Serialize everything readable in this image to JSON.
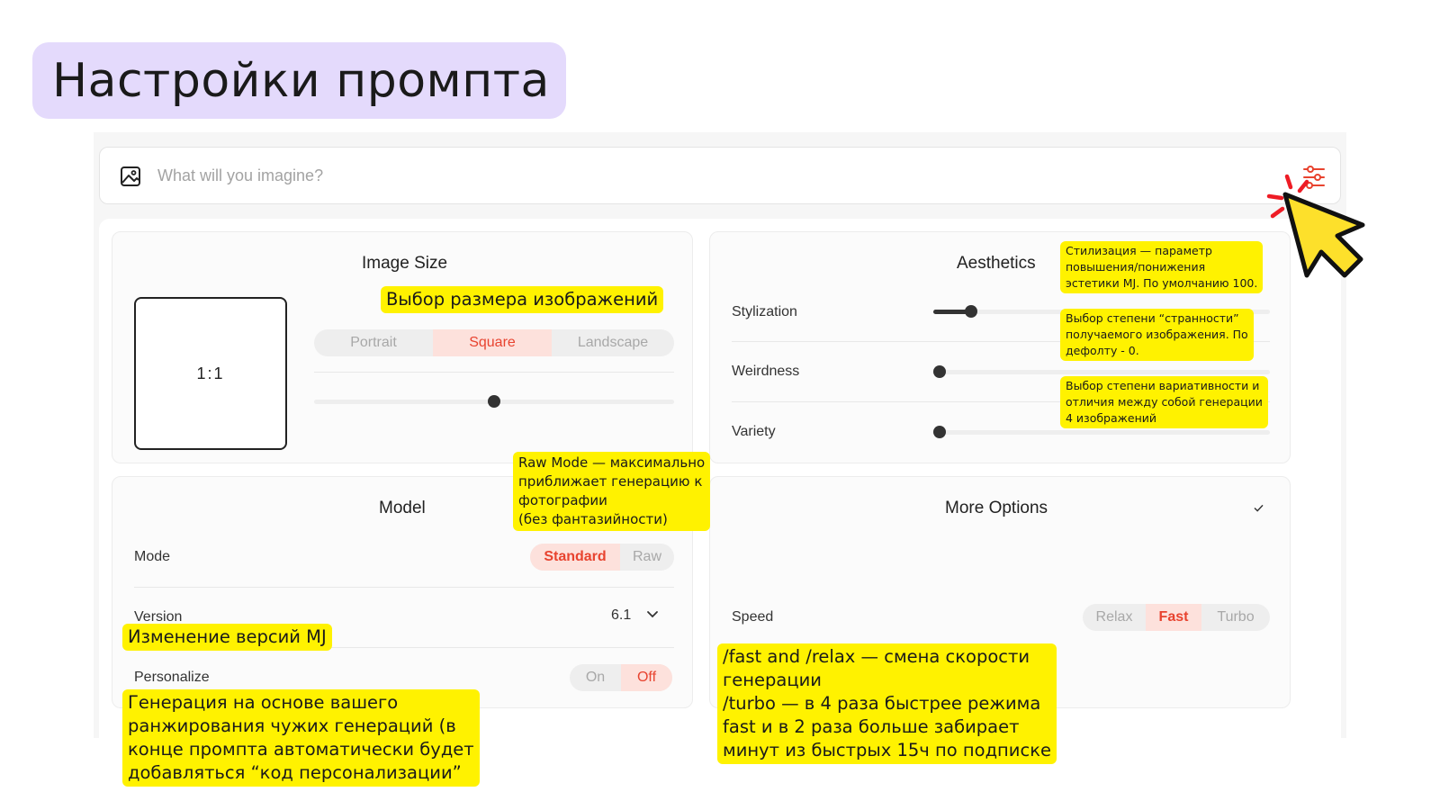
{
  "slide": {
    "title": "Настройки промпта"
  },
  "prompt": {
    "placeholder": "What will you imagine?"
  },
  "image_size": {
    "title": "Image Size",
    "aspect": "1:1",
    "orientation_options": [
      "Portrait",
      "Square",
      "Landscape"
    ],
    "orientation_selected": "Square",
    "slider_value": 0.5
  },
  "aesthetics": {
    "title": "Aesthetics",
    "rows": [
      {
        "label": "Stylization",
        "value": 0.1
      },
      {
        "label": "Weirdness",
        "value": 0
      },
      {
        "label": "Variety",
        "value": 0
      }
    ]
  },
  "model": {
    "title": "Model",
    "mode_label": "Mode",
    "mode_options": [
      "Standard",
      "Raw"
    ],
    "mode_selected": "Standard",
    "version_label": "Version",
    "version_value": "6.1",
    "personalize_label": "Personalize",
    "personalize_options": [
      "On",
      "Off"
    ],
    "personalize_selected": "Off"
  },
  "more_options": {
    "title": "More Options",
    "speed_label": "Speed",
    "speed_options": [
      "Relax",
      "Fast",
      "Turbo"
    ],
    "speed_selected": "Fast"
  },
  "annotations": {
    "image_size": "Выбор размера изображений",
    "stylization": [
      "Стилизация — параметр",
      "повышения/понижения",
      "эстетики MJ.  По умолчанию 100."
    ],
    "weirdness": [
      "Выбор степени “странности”",
      "получаемого изображения. По",
      "дефолту - 0."
    ],
    "variety": [
      "Выбор степени вариативности и",
      "отличия между собой генерации",
      "4 изображений"
    ],
    "raw_mode": [
      "Raw Mode — максимально",
      "приближает генерацию к",
      "фотографии",
      "(без фантазийности)"
    ],
    "version": "Изменение версий MJ",
    "personalize": [
      "Генерация на основе вашего",
      "ранжирования чужих генераций (в",
      "конце промпта автоматически будет",
      "добавляться “код персонализации”"
    ],
    "speed": [
      "/fast and /relax — смена скорости",
      "генерации",
      "/turbo — в 4 раза быстрее режима",
      "fast и в 2 раза больше забирает",
      "минут из быстрых 15ч по подписке"
    ]
  },
  "colors": {
    "accent": "#e8432f",
    "highlight": "#fff200",
    "title_bg": "#e4dafc"
  }
}
